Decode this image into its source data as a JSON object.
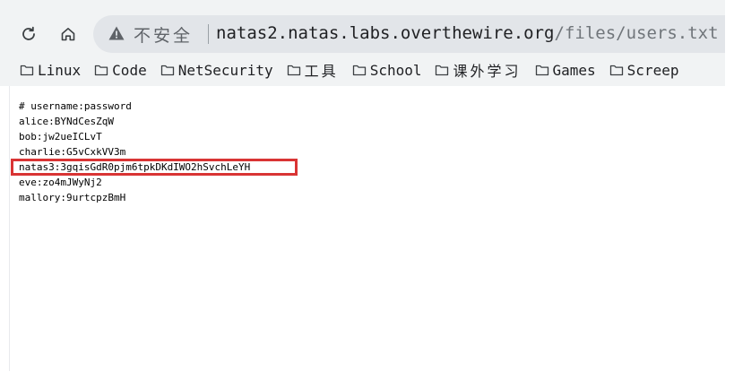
{
  "toolbar": {
    "reload_icon": "reload-icon",
    "home_icon": "home-icon"
  },
  "address_bar": {
    "warning_icon": "warning-triangle-icon",
    "security_label": "不安全",
    "url_host": "natas2.natas.labs.overthewire.org",
    "url_path": "/files/users.txt"
  },
  "bookmarks": [
    {
      "label": "Linux"
    },
    {
      "label": "Code"
    },
    {
      "label": "NetSecurity"
    },
    {
      "label": "工具"
    },
    {
      "label": "School"
    },
    {
      "label": "课外学习"
    },
    {
      "label": "Games"
    },
    {
      "label": "Screep"
    }
  ],
  "file": {
    "lines": [
      "# username:password",
      "alice:BYNdCesZqW",
      "bob:jw2ueICLvT",
      "charlie:G5vCxkVV3m",
      "natas3:3gqisGdR0pjm6tpkDKdIWO2hSvchLeYH",
      "eve:zo4mJWyNj2",
      "mallory:9urtcpzBmH"
    ],
    "highlighted_line": 4
  },
  "colors": {
    "highlight": "#d93434",
    "chrome_bg": "#f1f3f4",
    "omnibox_bg": "#e2e5e9"
  }
}
